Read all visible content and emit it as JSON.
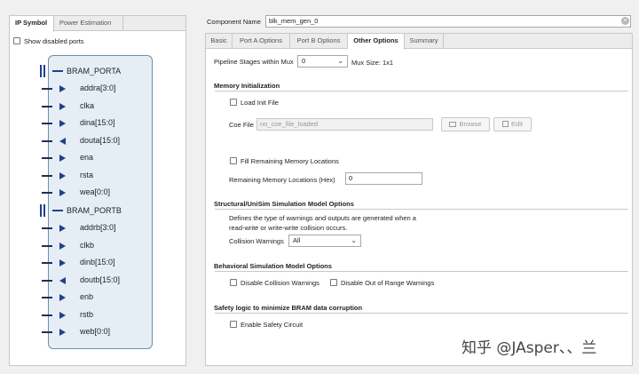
{
  "left_tabs": [
    "IP Symbol",
    "Power Estimation"
  ],
  "show_disabled_ports": "Show disabled ports",
  "symbol": {
    "porta": {
      "name": "BRAM_PORTA",
      "ports": [
        {
          "label": "addra[3:0]",
          "dir": "in"
        },
        {
          "label": "clka",
          "dir": "in"
        },
        {
          "label": "dina[15:0]",
          "dir": "in"
        },
        {
          "label": "douta[15:0]",
          "dir": "out"
        },
        {
          "label": "ena",
          "dir": "in"
        },
        {
          "label": "rsta",
          "dir": "in"
        },
        {
          "label": "wea[0:0]",
          "dir": "in"
        }
      ]
    },
    "portb": {
      "name": "BRAM_PORTB",
      "ports": [
        {
          "label": "addrb[3:0]",
          "dir": "in"
        },
        {
          "label": "clkb",
          "dir": "in"
        },
        {
          "label": "dinb[15:0]",
          "dir": "in"
        },
        {
          "label": "doutb[15:0]",
          "dir": "out"
        },
        {
          "label": "enb",
          "dir": "in"
        },
        {
          "label": "rstb",
          "dir": "in"
        },
        {
          "label": "web[0:0]",
          "dir": "in"
        }
      ]
    }
  },
  "component": {
    "label": "Component Name",
    "value": "blk_mem_gen_0"
  },
  "right_tabs": [
    "Basic",
    "Port A Options",
    "Port B Options",
    "Other Options",
    "Summary"
  ],
  "active_tab": "Other Options",
  "pipeline": {
    "label": "Pipeline Stages within Mux",
    "value": "0",
    "mux_size": "Mux Size: 1x1"
  },
  "mem_init": {
    "title": "Memory Initialization",
    "load_init": "Load Init File",
    "coe_label": "Coe File",
    "coe_value": "no_coe_file_loaded",
    "browse": "Browse",
    "edit": "Edit",
    "fill_remaining": "Fill Remaining Memory Locations",
    "remaining_label": "Remaining Memory Locations (Hex)",
    "remaining_value": "0"
  },
  "structural": {
    "title": "Structural/UniSim Simulation Model Options",
    "desc1": "Defines the type of warnings and outputs are generated when a",
    "desc2": "read-write or write-write collision occurs.",
    "collision_label": "Collision Warnings",
    "collision_value": "All"
  },
  "behavioral": {
    "title": "Behavioral Simulation Model Options",
    "disable_collision": "Disable Collision Warnings",
    "disable_oor": "Disable Out of Range Warnings"
  },
  "safety": {
    "title": "Safety logic to minimize BRAM data corruption",
    "enable": "Enable Safety Circuit"
  },
  "watermark": "知乎 @JAsper、、兰",
  "colors": {
    "port_arrow": "#1f3f8f",
    "symbol_fill": "#e6eef5",
    "symbol_border": "#6f8fa8"
  }
}
